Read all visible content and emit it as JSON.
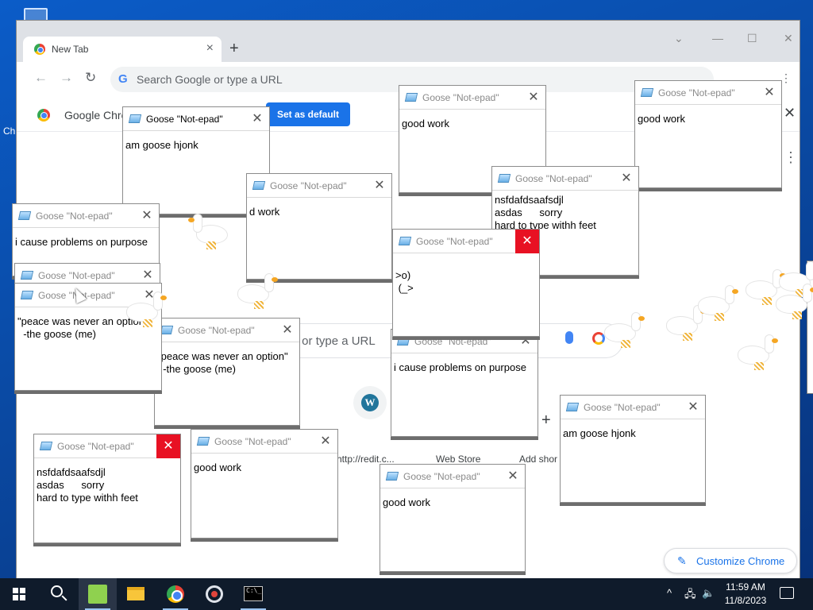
{
  "desktop": {
    "edge_label": "Ch"
  },
  "browser": {
    "tab": {
      "title": "New Tab",
      "close": "×"
    },
    "new_tab": "+",
    "window_controls": {
      "dropdown": "⌄",
      "minimize": "—",
      "maximize": "☐",
      "close": "✕"
    },
    "omnibox_placeholder": "Search Google or type a URL",
    "g_glyph": "G",
    "infobar": {
      "text": "Google Chrome",
      "button": "Set as default",
      "close": "✕"
    },
    "ntp": {
      "search_text": "gle or type a URL",
      "shortcuts": [
        "http://redit.c...",
        "Web Store",
        "Add shor"
      ],
      "wordpress_glyph": "W",
      "add_glyph": "+",
      "customize": "Customize Chrome"
    }
  },
  "notepads": [
    {
      "title": "Goose \"Not-epad\"",
      "text": "am goose hjonk"
    },
    {
      "title": "Goose \"Not-epad\"",
      "text": "good work"
    },
    {
      "title": "Goose \"Not-epad\"",
      "text": "good work"
    },
    {
      "title": "Goose \"Not-epad\"",
      "text": "nsfdafdsaafsdjl\nasdas      sorry\nhard to type withh feet"
    },
    {
      "title": "Goose \"Not-epad\"",
      "text": "d work"
    },
    {
      "title": "Goose \"Not-epad\"",
      "text": "i cause problems on purpose"
    },
    {
      "title": "Goose \"Not-epad\"",
      "text": ""
    },
    {
      "title": "Goose \"Not-epad\"",
      "text": "\"peace was never an option\"\n  -the goose (me)"
    },
    {
      "title": "Goose \"Not-epad\"",
      "text": "\"peace was never an option\"\n  -the goose (me)"
    },
    {
      "title": "Goose \"Not-epad\"",
      "text": ">o)\n (_>"
    },
    {
      "title": "Goose \"Not-epad\"",
      "text": "i cause problems on purpose"
    },
    {
      "title": "Goose \"Not-epad\"",
      "text": "nsfdafdsaafsdjl\nasdas      sorry\nhard to type withh feet"
    },
    {
      "title": "Goose \"Not-epad\"",
      "text": "good work"
    },
    {
      "title": "Goose \"Not-epad\"",
      "text": "good work"
    },
    {
      "title": "Goose \"Not-epad\"",
      "text": "am goose hjonk"
    }
  ],
  "notepad_close_glyph": "✕",
  "taskbar": {
    "clock_time": "11:59 AM",
    "clock_date": "11/8/2023",
    "cmd_glyph": "C:\\_",
    "tray": {
      "chevron": "^",
      "network": "🖧",
      "volume": "🔈"
    }
  }
}
